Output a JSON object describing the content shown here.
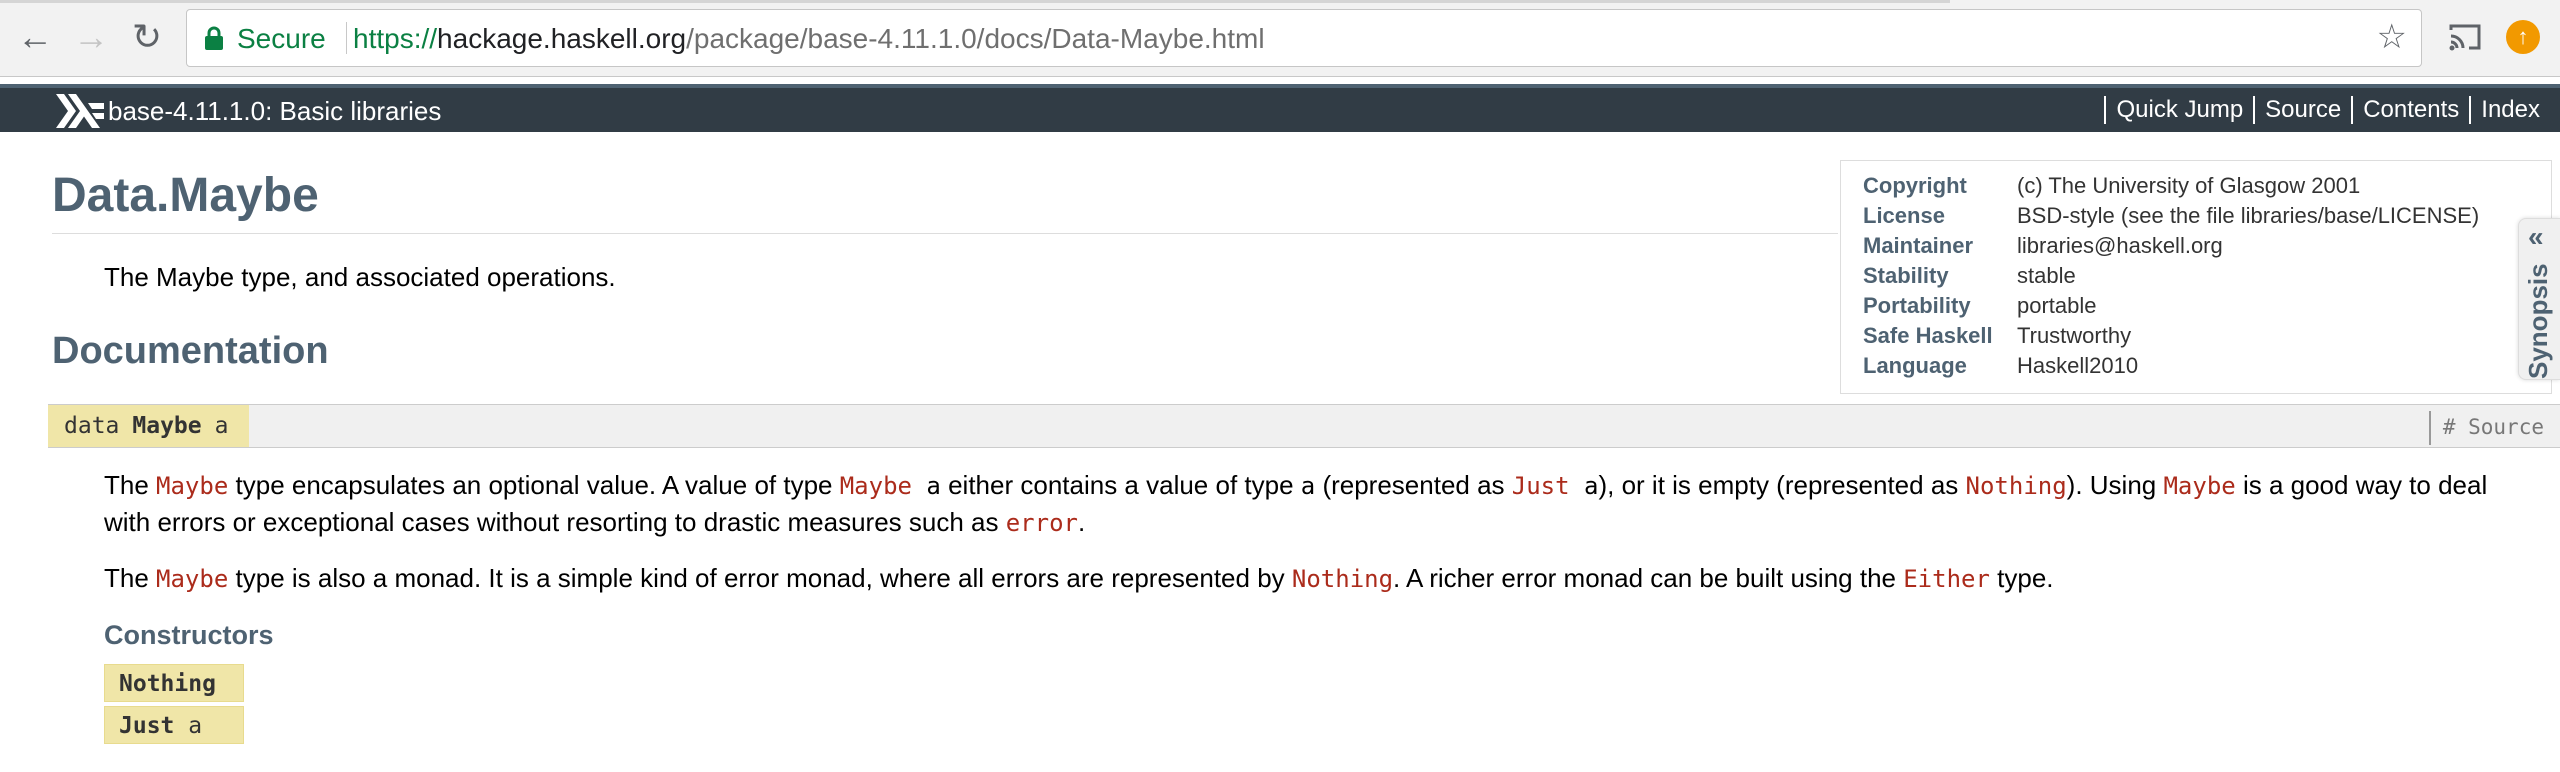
{
  "browser": {
    "secure_label": "Secure",
    "url_scheme": "https://",
    "url_host": "hackage.haskell.org",
    "url_path": "/package/base-4.11.1.0/docs/Data-Maybe.html",
    "icons": [
      "back-icon",
      "forward-icon",
      "reload-icon",
      "lock-icon",
      "star-icon",
      "cast-icon",
      "update-icon"
    ]
  },
  "header": {
    "caption": "base-4.11.1.0: Basic libraries",
    "links": [
      "Quick Jump",
      "Source",
      "Contents",
      "Index"
    ]
  },
  "module": {
    "title": "Data.Maybe",
    "description": "The Maybe type, and associated operations.",
    "doc_heading": "Documentation"
  },
  "info": {
    "rows": [
      {
        "key": "Copyright",
        "value": "(c) The University of Glasgow 2001"
      },
      {
        "key": "License",
        "value": "BSD-style (see the file libraries/base/LICENSE)"
      },
      {
        "key": "Maintainer",
        "value": "libraries@haskell.org"
      },
      {
        "key": "Stability",
        "value": "stable"
      },
      {
        "key": "Portability",
        "value": "portable"
      },
      {
        "key": "Safe Haskell",
        "value": "Trustworthy"
      },
      {
        "key": "Language",
        "value": "Haskell2010"
      }
    ]
  },
  "synopsis": {
    "label": "Synopsis",
    "chevrons": "«"
  },
  "decl": {
    "keyword": "data",
    "name": "Maybe",
    "tyvar": "a",
    "source_label": "# Source"
  },
  "para1": {
    "t1": "The ",
    "c1": "Maybe",
    "t2": " type encapsulates an optional value. A value of type ",
    "c2": "Maybe",
    "c2b": " a",
    "t3": " either contains a value of type ",
    "c3": "a",
    "t4": " (represented as ",
    "c4": "Just",
    "c4b": " a",
    "t5": "), or it is empty (represented as ",
    "c5": "Nothing",
    "t6": "). Using ",
    "c6": "Maybe",
    "t7": " is a good way to deal with errors or exceptional cases without resorting to drastic measures such as ",
    "c7": "error",
    "t8": "."
  },
  "para2": {
    "t1": "The ",
    "c1": "Maybe",
    "t2": " type is also a monad. It is a simple kind of error monad, where all errors are represented by ",
    "c2": "Nothing",
    "t3": ". A richer error monad can be built using the ",
    "c3": "Either",
    "t4": " type."
  },
  "constructors": {
    "heading": "Constructors",
    "items": [
      {
        "name": "Nothing",
        "arg": ""
      },
      {
        "name": "Just",
        "arg": "a"
      }
    ]
  }
}
